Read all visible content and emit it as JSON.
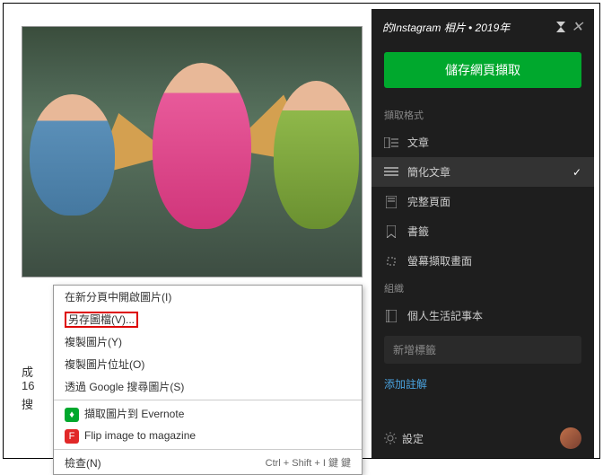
{
  "header": {
    "title": "的Instagram 相片 • 2019年"
  },
  "save_button": "儲存網頁擷取",
  "sections": {
    "format": "擷取格式",
    "org": "組織"
  },
  "formats": [
    {
      "id": "article",
      "label": "文章",
      "icon": "article-icon"
    },
    {
      "id": "simplified",
      "label": "簡化文章",
      "icon": "lines-icon",
      "selected": true
    },
    {
      "id": "fullpage",
      "label": "完整頁面",
      "icon": "page-icon"
    },
    {
      "id": "bookmark",
      "label": "書籤",
      "icon": "bookmark-icon"
    },
    {
      "id": "screenshot",
      "label": "螢幕擷取畫面",
      "icon": "crop-icon"
    }
  ],
  "notebook": {
    "label": "個人生活記事本"
  },
  "tag_input": {
    "placeholder": "新增標籤"
  },
  "annotate": "添加註解",
  "settings": "設定",
  "context_menu": {
    "items": [
      {
        "id": "open",
        "label": "在新分頁中開啟圖片(I)"
      },
      {
        "id": "saveas",
        "label": "另存圖檔(V)...",
        "highlighted": true
      },
      {
        "id": "copy",
        "label": "複製圖片(Y)"
      },
      {
        "id": "copyaddr",
        "label": "複製圖片位址(O)"
      },
      {
        "id": "gsearch",
        "label": "透過 Google 搜尋圖片(S)"
      }
    ],
    "ext": [
      {
        "id": "evernote",
        "icon": "ev",
        "label": "擷取圖片到 Evernote"
      },
      {
        "id": "flipboard",
        "icon": "fb",
        "label": "Flip image to magazine"
      }
    ],
    "inspect": {
      "label": "檢查(N)",
      "shortcut": "Ctrl + Shift + I 鍵 鍵"
    }
  },
  "page_text": {
    "l1": "成",
    "l2": "16",
    "l3": "搜"
  }
}
